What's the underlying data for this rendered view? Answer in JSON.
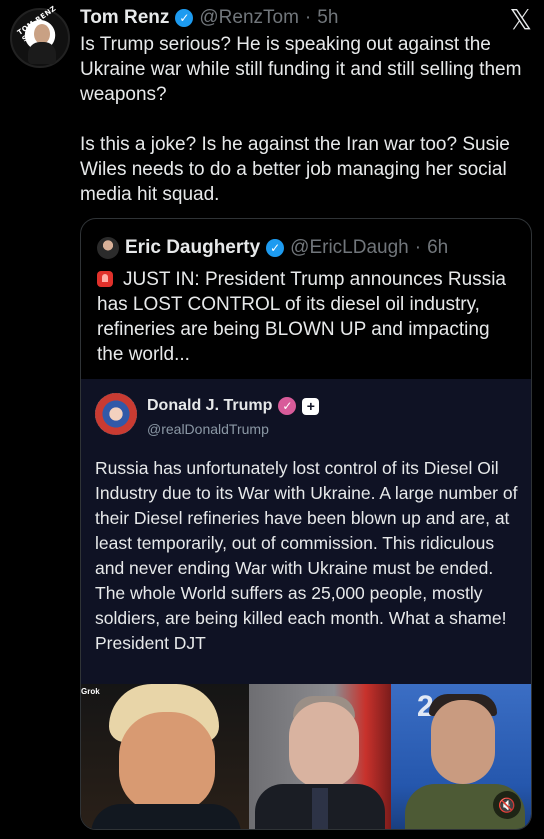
{
  "post": {
    "author_name": "Tom Renz",
    "author_handle": "@RenzTom",
    "separator": "·",
    "time": "5h",
    "text": "Is Trump serious? He is speaking out against the Ukraine war while still funding it and still selling them weapons?\n\nIs this a joke? Is he against the Iran war too? Susie Wiles needs to do a better job managing her social media hit squad.",
    "avatar_ring_text": "TOM RENZ SHOW",
    "x_logo": "𝕏"
  },
  "quote": {
    "author_name": "Eric Daugherty",
    "author_handle": "@EricLDaugh",
    "separator": "·",
    "time": "6h",
    "text": "JUST IN: President Trump announces Russia has LOST CONTROL of its diesel oil industry, refineries are being BLOWN UP and impacting the world..."
  },
  "embedded": {
    "author_name": "Donald J. Trump",
    "author_handle": "@realDonaldTrump",
    "text": "Russia has unfortunately lost control of its Diesel Oil Industry due to its War with Ukraine. A large number of their Diesel refineries have been blown up and are, at least temporarily, out of commission. This ridiculous and never ending War with Ukraine must be ended. The whole World suffers as 25,000 people, mostly soldiers, are being killed each month. What a shame! President DJT",
    "media_label": "Grok",
    "photo3_text": "2"
  },
  "icons": {
    "verified": "✓",
    "plus": "+",
    "mute": "🔇"
  },
  "colors": {
    "background": "#000000",
    "verified_blue": "#1d9bf0",
    "inner_card": "#0f1224",
    "muted_text": "#71767b"
  }
}
